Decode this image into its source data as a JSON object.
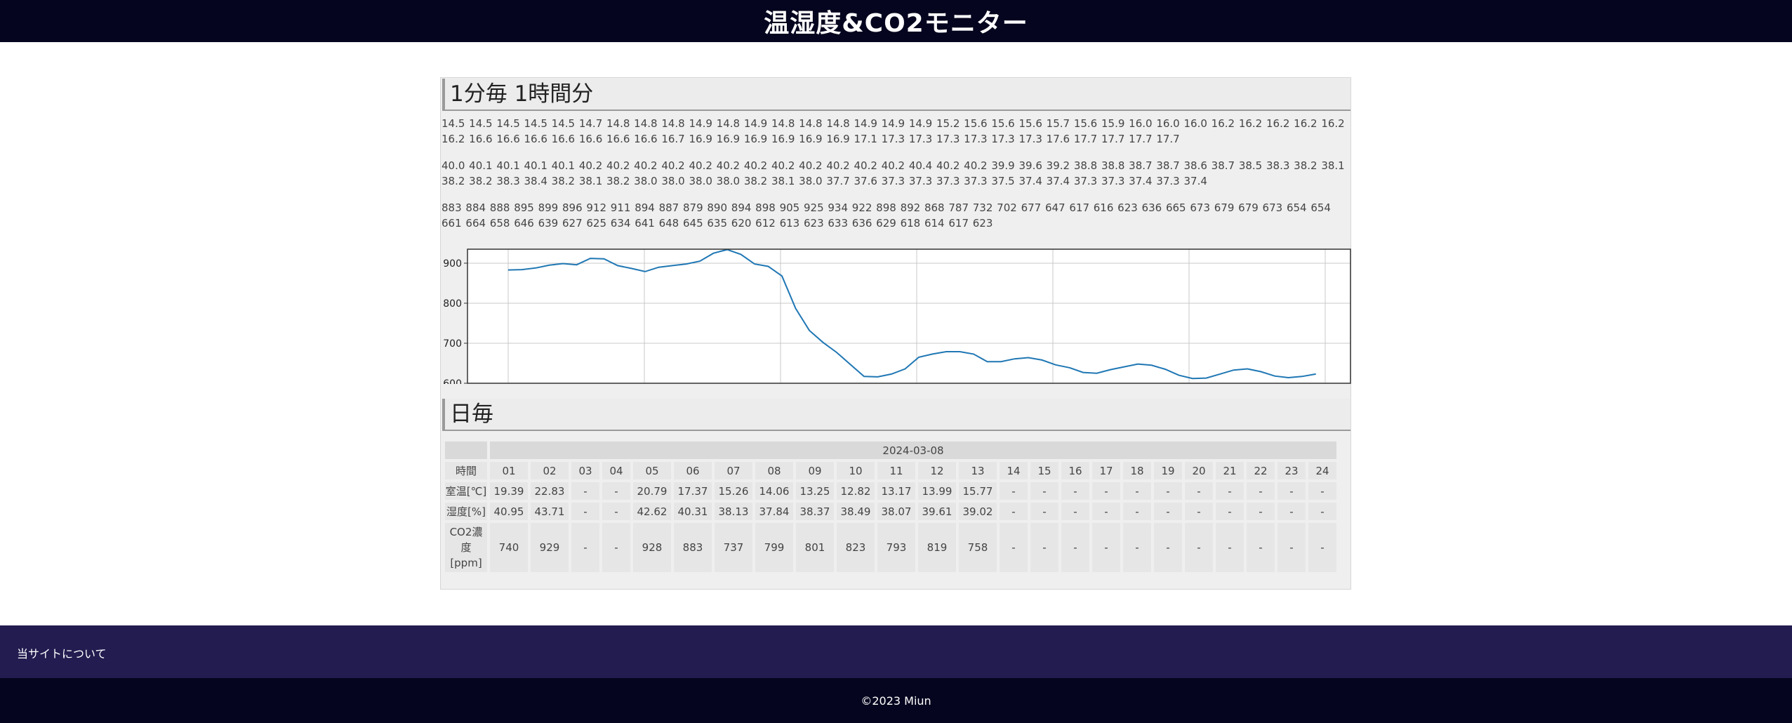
{
  "header": {
    "title": "温湿度&CO2モニター"
  },
  "minute_section": {
    "heading": "1分毎 1時間分",
    "temperature_line": "14.5 14.5 14.5 14.5 14.5 14.7 14.8 14.8 14.8 14.9 14.8 14.9 14.8 14.8 14.8 14.9 14.9 14.9 15.2 15.6 15.6 15.6 15.7 15.6 15.9 16.0 16.0 16.0 16.2 16.2 16.2 16.2 16.2 16.2 16.6 16.6 16.6 16.6 16.6 16.6 16.6 16.7 16.9 16.9 16.9 16.9 16.9 16.9 17.1 17.3 17.3 17.3 17.3 17.3 17.3 17.6 17.7 17.7 17.7 17.7",
    "humidity_line": "40.0 40.1 40.1 40.1 40.1 40.2 40.2 40.2 40.2 40.2 40.2 40.2 40.2 40.2 40.2 40.2 40.2 40.4 40.2 40.2 39.9 39.6 39.2 38.8 38.8 38.7 38.7 38.6 38.7 38.5 38.3 38.2 38.1 38.2 38.2 38.3 38.4 38.2 38.1 38.2 38.0 38.0 38.0 38.0 38.2 38.1 38.0 37.7 37.6 37.3 37.3 37.3 37.3 37.5 37.4 37.4 37.3 37.3 37.4 37.3 37.4",
    "co2_line": "883 884 888 895 899 896 912 911 894 887 879 890 894 898 905 925 934 922 898 892 868 787 732 702 677 647 617 616 623 636 665 673 679 679 673 654 654 661 664 658 646 639 627 625 634 641 648 645 635 620 612 613 623 633 636 629 618 614 617 623"
  },
  "chart_data": {
    "type": "line",
    "title": "",
    "xlabel": "",
    "ylabel": "",
    "ylim": [
      600,
      935
    ],
    "yticks": [
      "600",
      "700",
      "800",
      "900"
    ],
    "grid": true,
    "series": [
      {
        "name": "",
        "color": "#1f77b4",
        "values": [
          883,
          884,
          888,
          895,
          899,
          896,
          912,
          911,
          894,
          887,
          879,
          890,
          894,
          898,
          905,
          925,
          934,
          922,
          898,
          892,
          868,
          787,
          732,
          702,
          677,
          647,
          617,
          616,
          623,
          636,
          665,
          673,
          679,
          679,
          673,
          654,
          654,
          661,
          664,
          658,
          646,
          639,
          627,
          625,
          634,
          641,
          648,
          645,
          635,
          620,
          612,
          613,
          623,
          633,
          636,
          629,
          618,
          614,
          617,
          623
        ]
      }
    ]
  },
  "daily_section": {
    "heading": "日毎",
    "date": "2024-03-08",
    "hour_label": "時間",
    "hours": [
      "01",
      "02",
      "03",
      "04",
      "05",
      "06",
      "07",
      "08",
      "09",
      "10",
      "11",
      "12",
      "13",
      "14",
      "15",
      "16",
      "17",
      "18",
      "19",
      "20",
      "21",
      "22",
      "23",
      "24"
    ],
    "rows": [
      {
        "label": "室温[℃]",
        "values": [
          "19.39",
          "22.83",
          "-",
          "-",
          "20.79",
          "17.37",
          "15.26",
          "14.06",
          "13.25",
          "12.82",
          "13.17",
          "13.99",
          "15.77",
          "-",
          "-",
          "-",
          "-",
          "-",
          "-",
          "-",
          "-",
          "-",
          "-",
          "-"
        ]
      },
      {
        "label": "湿度[%]",
        "values": [
          "40.95",
          "43.71",
          "-",
          "-",
          "42.62",
          "40.31",
          "38.13",
          "37.84",
          "38.37",
          "38.49",
          "38.07",
          "39.61",
          "39.02",
          "-",
          "-",
          "-",
          "-",
          "-",
          "-",
          "-",
          "-",
          "-",
          "-",
          "-"
        ]
      },
      {
        "label": "CO2濃度[ppm]",
        "values": [
          "740",
          "929",
          "-",
          "-",
          "928",
          "883",
          "737",
          "799",
          "801",
          "823",
          "793",
          "819",
          "758",
          "-",
          "-",
          "-",
          "-",
          "-",
          "-",
          "-",
          "-",
          "-",
          "-",
          "-"
        ]
      }
    ]
  },
  "footer": {
    "about_link": "当サイトについて",
    "copyright": "©2023 Miun"
  }
}
